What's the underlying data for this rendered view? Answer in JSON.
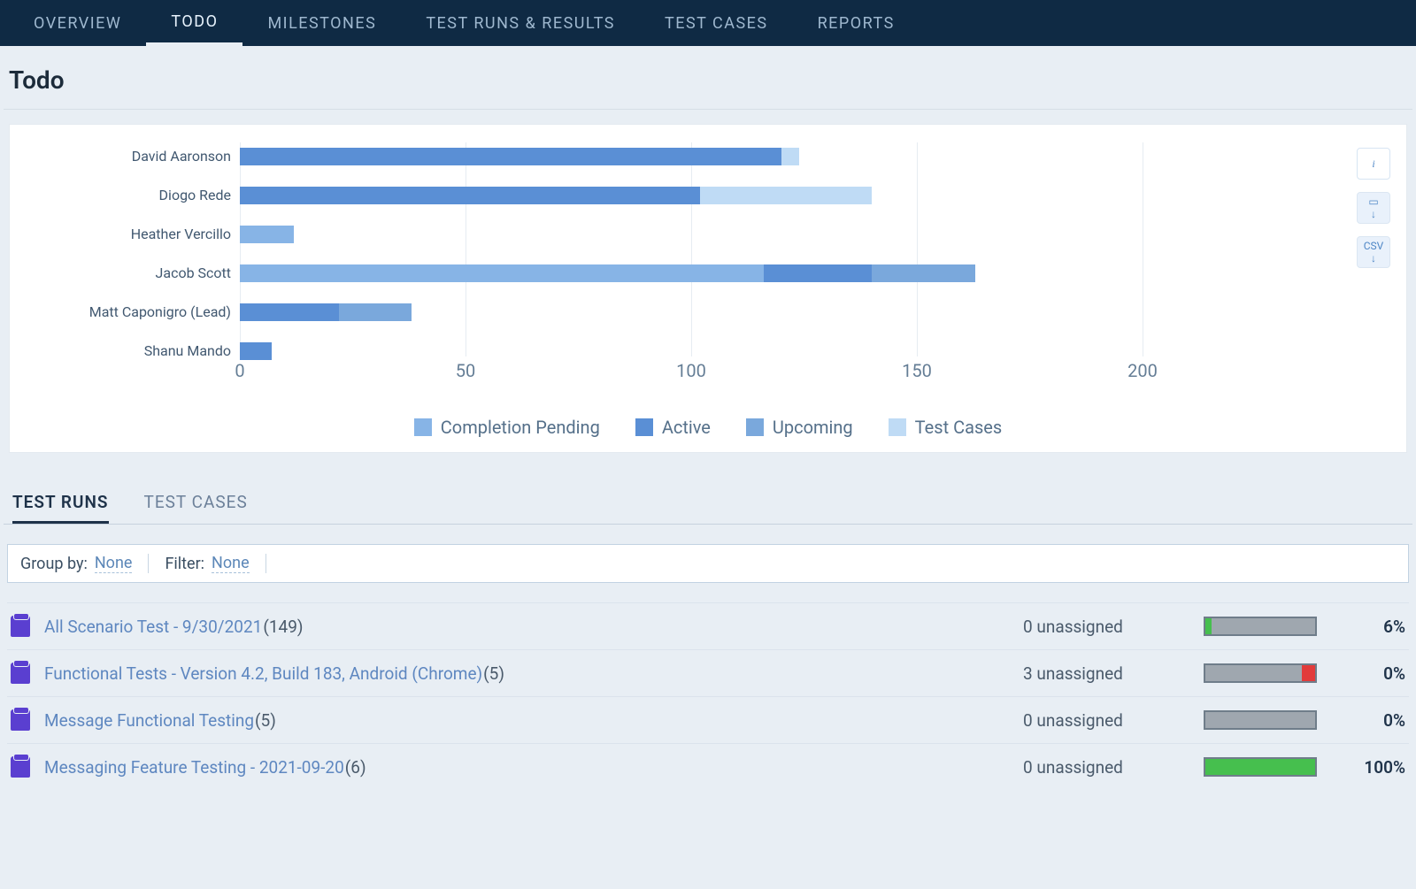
{
  "nav": {
    "items": [
      "OVERVIEW",
      "TODO",
      "MILESTONES",
      "TEST RUNS & RESULTS",
      "TEST CASES",
      "REPORTS"
    ],
    "active_index": 1
  },
  "page_title": "Todo",
  "chart_data": {
    "type": "bar",
    "orientation": "horizontal",
    "stacked": true,
    "categories": [
      "David Aaronson",
      "Diogo Rede",
      "Heather Vercillo",
      "Jacob Scott",
      "Matt Caponigro (Lead)",
      "Shanu Mando"
    ],
    "series": [
      {
        "name": "Completion Pending",
        "color": "#87b4e6",
        "values": [
          0,
          0,
          12,
          116,
          0,
          0
        ]
      },
      {
        "name": "Active",
        "color": "#5a8fd5",
        "values": [
          120,
          102,
          0,
          24,
          22,
          7
        ]
      },
      {
        "name": "Upcoming",
        "color": "#7aa8dc",
        "values": [
          0,
          0,
          0,
          23,
          16,
          0
        ]
      },
      {
        "name": "Test Cases",
        "color": "#bfdbf5",
        "values": [
          4,
          38,
          0,
          0,
          0,
          0
        ]
      }
    ],
    "xlim": [
      0,
      200
    ],
    "x_ticks": [
      0,
      50,
      100,
      150,
      200
    ],
    "legend": [
      "Completion Pending",
      "Active",
      "Upcoming",
      "Test Cases"
    ]
  },
  "chart_actions": {
    "info": "i",
    "image_download": "img",
    "csv": "CSV"
  },
  "subtabs": {
    "items": [
      "TEST RUNS",
      "TEST CASES"
    ],
    "active_index": 0
  },
  "filter": {
    "group_by_label": "Group by:",
    "group_by_value": "None",
    "filter_label": "Filter:",
    "filter_value": "None"
  },
  "runs": [
    {
      "name": "All Scenario Test - 9/30/2021",
      "count": "(149)",
      "unassigned": "0 unassigned",
      "green_pct": 6,
      "red_pct": 0,
      "percent_text": "6%"
    },
    {
      "name": "Functional Tests - Version 4.2, Build 183, Android (Chrome)",
      "count": "(5)",
      "unassigned": "3 unassigned",
      "green_pct": 0,
      "red_pct": 12,
      "percent_text": "0%"
    },
    {
      "name": "Message Functional Testing",
      "count": "(5)",
      "unassigned": "0 unassigned",
      "green_pct": 0,
      "red_pct": 0,
      "percent_text": "0%"
    },
    {
      "name": "Messaging Feature Testing - 2021-09-20",
      "count": "(6)",
      "unassigned": "0 unassigned",
      "green_pct": 100,
      "red_pct": 0,
      "percent_text": "100%"
    }
  ]
}
